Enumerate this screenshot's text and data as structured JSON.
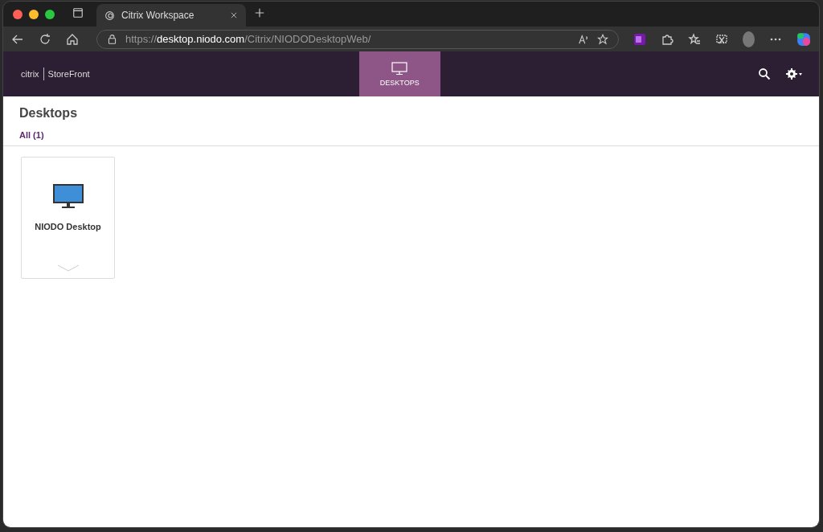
{
  "browser": {
    "tab": {
      "title": "Citrix Workspace",
      "selected": true
    },
    "url": "https://**desktop.niodo.com**/Citrix/NIODODesktopWeb/"
  },
  "header": {
    "logo": "citrix",
    "product": "StoreFront",
    "tabs": [
      {
        "label": "DESKTOPS",
        "selected": true
      }
    ]
  },
  "page": {
    "title": "Desktops",
    "filter": "All (1)"
  },
  "resources": [
    {
      "name": "NIODO Desktop"
    }
  ]
}
